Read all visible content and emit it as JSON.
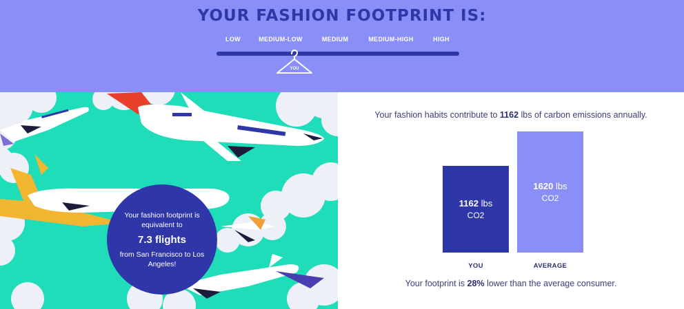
{
  "header": {
    "title": "YOUR FASHION FOOTPRINT IS:",
    "scale_labels": [
      "LOW",
      "MEDIUM-LOW",
      "MEDIUM",
      "MEDIUM-HIGH",
      "HIGH"
    ],
    "marker_label": "YOU",
    "selected_level": "MEDIUM-LOW"
  },
  "illustration": {
    "circle_line1": "Your fashion footprint is equivalent to",
    "circle_flights": "7.3 flights",
    "circle_line2": "from San Francisco to Los Angeles!"
  },
  "summary": {
    "prefix": "Your fashion habits contribute to ",
    "value": "1162",
    "suffix": " lbs of carbon emissions annually."
  },
  "chart_data": {
    "type": "bar",
    "categories": [
      "YOU",
      "AVERAGE"
    ],
    "values": [
      1162,
      1620
    ],
    "value_labels": [
      {
        "number": "1162",
        "unit": "lbs",
        "sub": "CO2"
      },
      {
        "number": "1620",
        "unit": "lbs",
        "sub": "CO2"
      }
    ],
    "colors": [
      "#2f37a8",
      "#8a8ff7"
    ]
  },
  "footnote": {
    "prefix": "Your footprint is ",
    "value": "28%",
    "suffix": " lower than the average consumer."
  },
  "colors": {
    "header_bg": "#8a8ff7",
    "accent_dark": "#2f37a8",
    "illustration_bg": "#1fddb9"
  }
}
